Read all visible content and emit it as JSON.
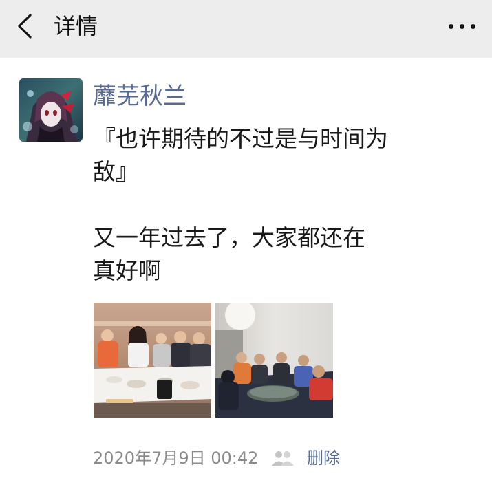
{
  "header": {
    "title": "详情",
    "back_icon": "chevron-left-icon",
    "more_icon": "more-horizontal-icon"
  },
  "post": {
    "nickname": "蘼芜秋兰",
    "content_lines": [
      "『也许期待的不过是与时间为",
      "敌』",
      "",
      "又一年过去了，大家都还在",
      "真好啊"
    ],
    "photos": [
      {
        "icon": "group-dinner-photo"
      },
      {
        "icon": "group-room-photo"
      }
    ],
    "time": "2020年7月9日 00:42",
    "visibility_icon": "people-icon",
    "delete_label": "删除"
  },
  "colors": {
    "nav_bg": "#ededed",
    "link": "#576b95",
    "text": "#191919",
    "meta": "#8a8a8a"
  }
}
